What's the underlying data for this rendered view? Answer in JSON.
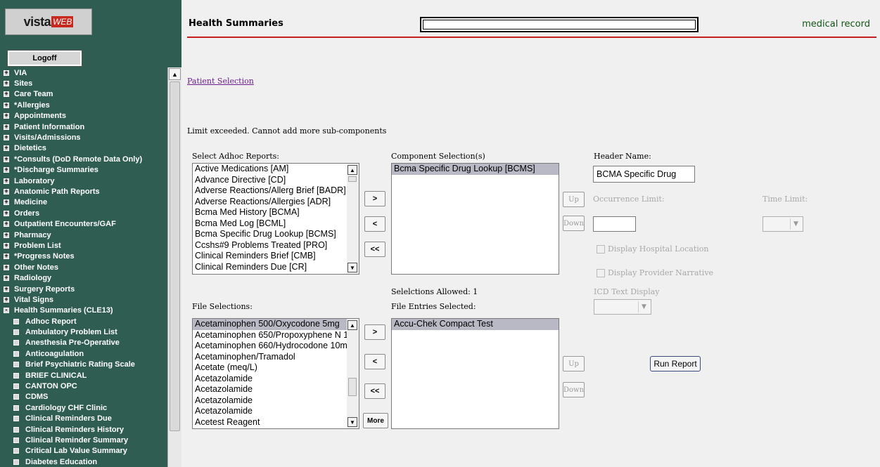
{
  "sidebar": {
    "logo_text": "vista",
    "logo_badge": "WEB",
    "logoff": "Logoff",
    "items": [
      {
        "label": "VIA",
        "icon": "box-plus-icon"
      },
      {
        "label": "Sites",
        "icon": "box-plus-icon"
      },
      {
        "label": "Care Team",
        "icon": "box-plus-icon"
      },
      {
        "label": "*Allergies",
        "icon": "box-plus-icon"
      },
      {
        "label": "Appointments",
        "icon": "box-plus-icon"
      },
      {
        "label": "Patient Information",
        "icon": "box-plus-icon"
      },
      {
        "label": "Visits/Admissions",
        "icon": "box-plus-icon"
      },
      {
        "label": "Dietetics",
        "icon": "box-plus-icon"
      },
      {
        "label": "*Consults (DoD Remote Data Only)",
        "icon": "box-plus-icon"
      },
      {
        "label": "*Discharge Summaries",
        "icon": "box-plus-icon"
      },
      {
        "label": "Laboratory",
        "icon": "box-plus-icon"
      },
      {
        "label": "Anatomic Path Reports",
        "icon": "box-plus-icon"
      },
      {
        "label": "Medicine",
        "icon": "box-plus-icon"
      },
      {
        "label": "Orders",
        "icon": "box-plus-icon"
      },
      {
        "label": "Outpatient Encounters/GAF",
        "icon": "box-plus-icon"
      },
      {
        "label": "Pharmacy",
        "icon": "box-plus-icon"
      },
      {
        "label": "Problem List",
        "icon": "box-plus-icon"
      },
      {
        "label": "*Progress Notes",
        "icon": "box-plus-icon"
      },
      {
        "label": "Other Notes",
        "icon": "box-plus-icon"
      },
      {
        "label": "Radiology",
        "icon": "box-plus-icon"
      },
      {
        "label": "Surgery Reports",
        "icon": "box-plus-icon"
      },
      {
        "label": "Vital Signs",
        "icon": "box-plus-icon"
      },
      {
        "label": "Health Summaries (CLE13)",
        "icon": "box-minus-icon"
      },
      {
        "label": "Adhoc Report",
        "icon": "box-icon"
      },
      {
        "label": "Ambulatory Problem List",
        "icon": "box-icon"
      },
      {
        "label": "Anesthesia Pre-Operative",
        "icon": "box-icon"
      },
      {
        "label": "Anticoagulation",
        "icon": "box-icon"
      },
      {
        "label": "Brief Psychiatric Rating Scale",
        "icon": "box-icon"
      },
      {
        "label": "BRIEF CLINICAL",
        "icon": "box-icon"
      },
      {
        "label": "CANTON OPC",
        "icon": "box-icon"
      },
      {
        "label": "CDMS",
        "icon": "box-icon"
      },
      {
        "label": "Cardiology CHF Clinic",
        "icon": "box-icon"
      },
      {
        "label": "Clinical Reminders Due",
        "icon": "box-icon"
      },
      {
        "label": "Clinical Reminders History",
        "icon": "box-icon"
      },
      {
        "label": "Clinical Reminder Summary",
        "icon": "box-icon"
      },
      {
        "label": "Critical Lab Value Summary",
        "icon": "box-icon"
      },
      {
        "label": "Diabetes Education",
        "icon": "box-icon"
      }
    ]
  },
  "header": {
    "title": "Health Summaries",
    "right": "medical record"
  },
  "main": {
    "patient_selection_link": "Patient Selection",
    "message": "Limit exceeded. Cannot add more sub-components",
    "select_adhoc_label": "Select Adhoc Reports:",
    "adhoc_reports": [
      "Active Medications [AM]",
      "Advance Directive [CD]",
      "Adverse Reactions/Allerg Brief [BADR]",
      "Adverse Reactions/Allergies [ADR]",
      "Bcma Med History [BCMA]",
      "Bcma Med Log [BCML]",
      "Bcma Specific Drug Lookup [BCMS]",
      "Ccshs#9 Problems Treated [PRO]",
      "Clinical Reminders Brief [CMB]",
      "Clinical Reminders Due [CR]"
    ],
    "component_selection_label": "Component Selection(s)",
    "component_selected": [
      "Bcma Specific Drug Lookup [BCMS]"
    ],
    "header_name_label": "Header Name:",
    "header_name_value": "BCMA Specific Drug",
    "occurrence_limit_label": "Occurrence Limit:",
    "time_limit_label": "Time Limit:",
    "display_hospital_location": "Display Hospital Location",
    "display_provider_narrative": "Display Provider Narrative",
    "icd_text_display_label": "ICD Text Display",
    "selections_allowed": "Selelctions Allowed: 1",
    "file_selections_label": "File Selections:",
    "file_entries_label": "File Entries Selected:",
    "file_selections": [
      "Acetaminophen 500/Oxycodone 5mg",
      "Acetaminophen 650/Propoxyphene N 1",
      "Acetaminophen 660/Hydrocodone 10m",
      "Acetaminophen/Tramadol",
      "Acetate (meq/L)",
      "Acetazolamide",
      "Acetazolamide",
      "Acetazolamide",
      "Acetazolamide",
      "Acetest Reagent"
    ],
    "file_entries_selected": [
      "Accu-Chek Compact Test"
    ],
    "buttons": {
      "add": ">",
      "remove": "<",
      "remove_all": "<<",
      "more": "More",
      "up": "Up",
      "down": "Down",
      "run_report": "Run Report"
    }
  }
}
